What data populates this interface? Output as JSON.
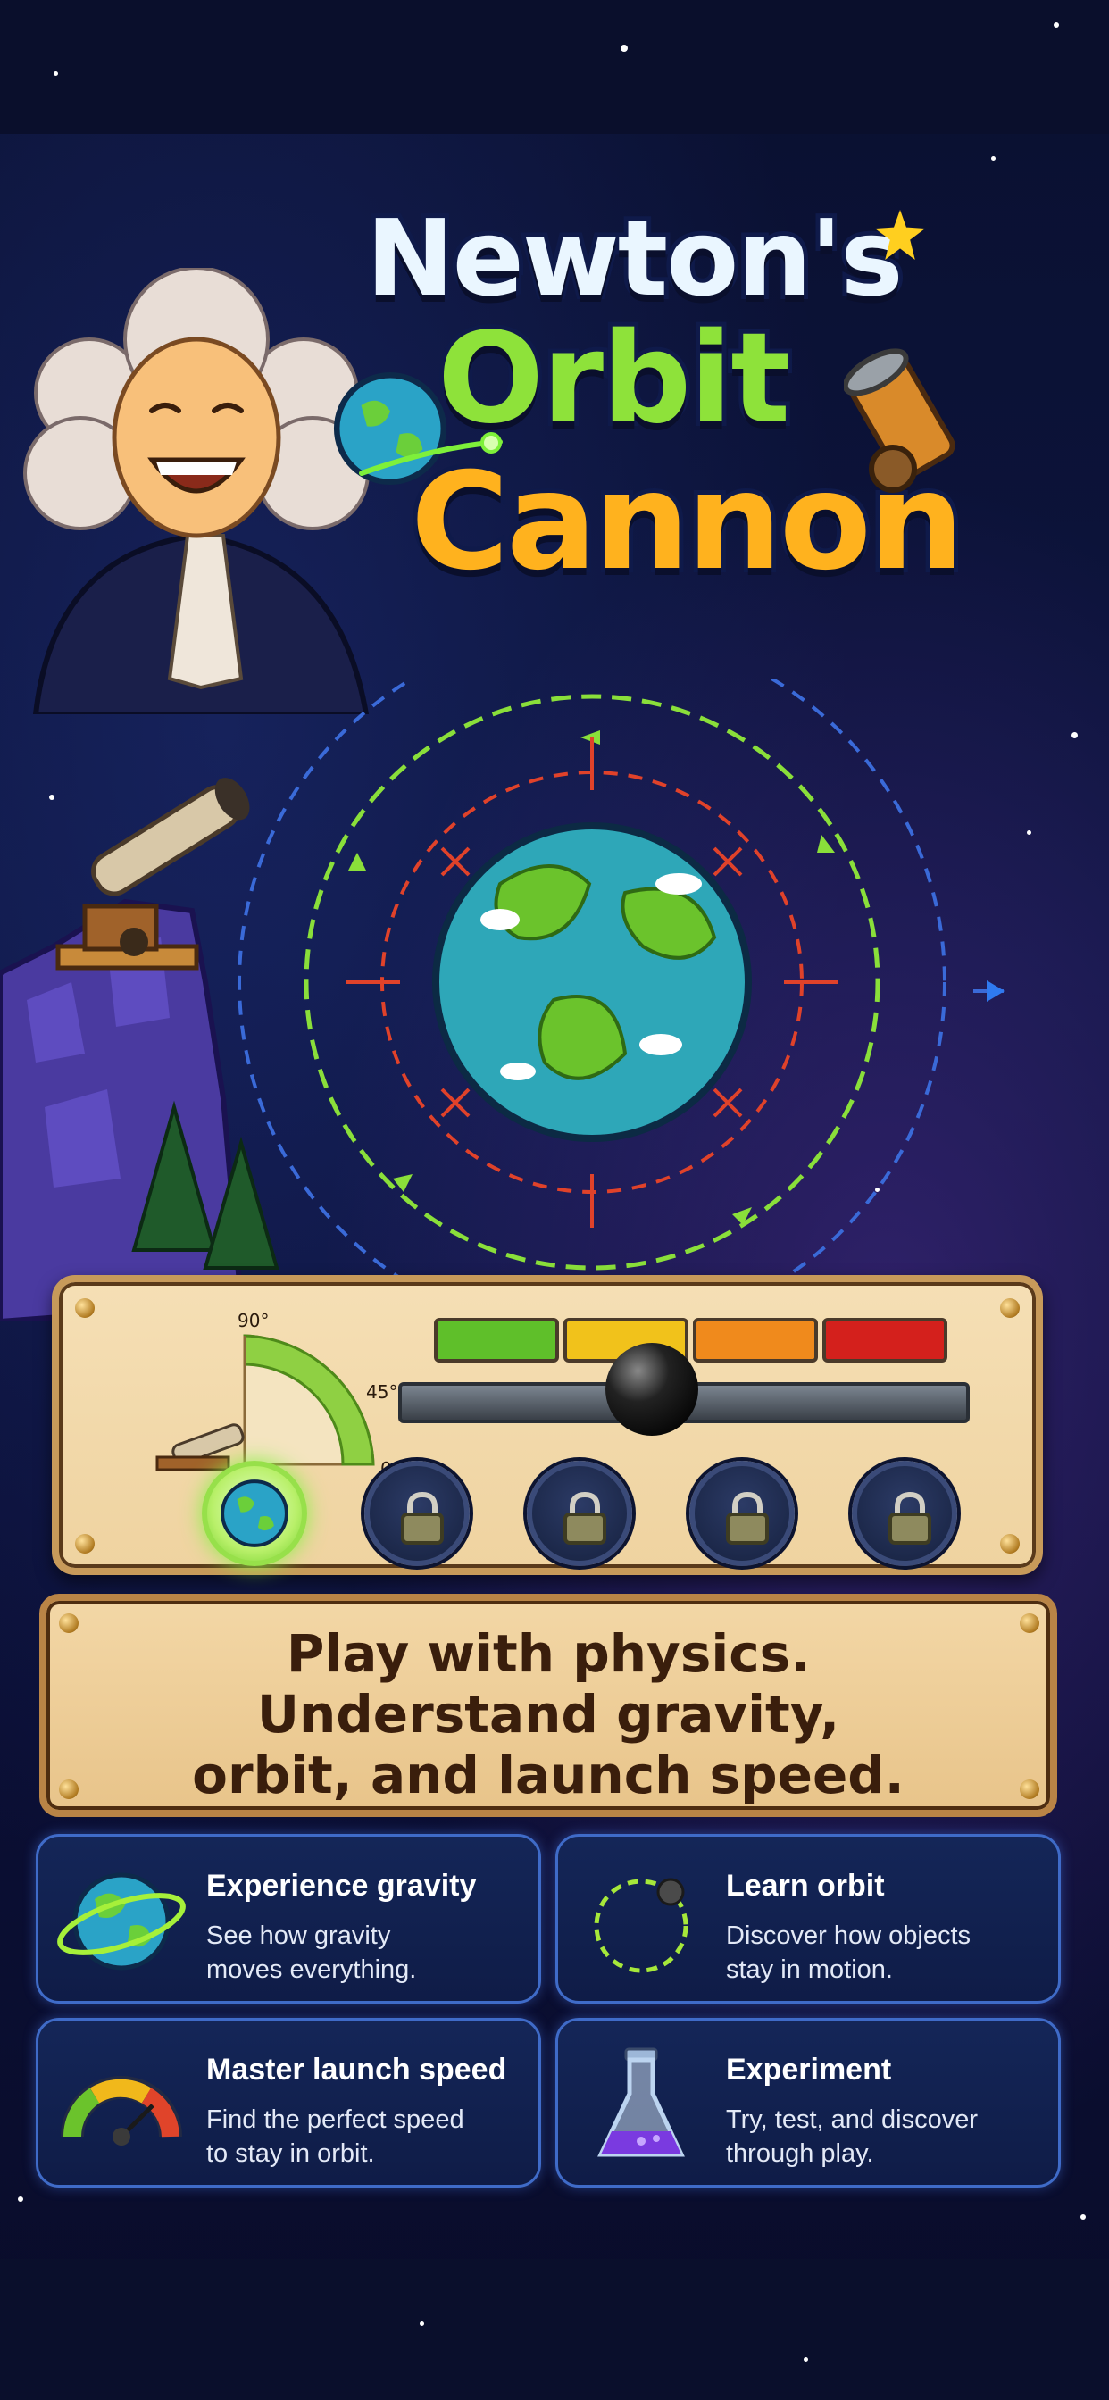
{
  "title": {
    "line1": "Newton's",
    "line2": "Orbit",
    "line3": "Cannon"
  },
  "launch_panel": {
    "angle_gauge": {
      "tick_90": "90°",
      "tick_45": "45°",
      "tick_0": "0°"
    },
    "power_bar_colors": [
      "#5fbf2a",
      "#f1c21b",
      "#f08a1c",
      "#d4201c"
    ],
    "levels": [
      {
        "state": "active",
        "icon": "earth-icon"
      },
      {
        "state": "locked",
        "icon": "padlock-icon"
      },
      {
        "state": "locked",
        "icon": "padlock-icon"
      },
      {
        "state": "locked",
        "icon": "padlock-icon"
      },
      {
        "state": "locked",
        "icon": "padlock-icon"
      }
    ]
  },
  "tagline": {
    "line1": "Play with physics.",
    "line2": "Understand gravity,",
    "line3": "orbit, and launch speed."
  },
  "features": [
    {
      "title": "Experience gravity",
      "desc_line1": "See how gravity",
      "desc_line2": "moves everything.",
      "icon": "ringed-earth-icon"
    },
    {
      "title": "Learn orbit",
      "desc_line1": "Discover how objects",
      "desc_line2": "stay in motion.",
      "icon": "orbit-path-icon"
    },
    {
      "title": "Master launch speed",
      "desc_line1": "Find the perfect speed",
      "desc_line2": "to stay in orbit.",
      "icon": "speedometer-icon"
    },
    {
      "title": "Experiment",
      "desc_line1": "Try, test, and discover",
      "desc_line2": "through play.",
      "icon": "flask-icon"
    }
  ],
  "colors": {
    "background": "#0b0f2e",
    "panel": "#f3d9a8",
    "card_border": "#3f6bc8",
    "title_white": "#eaf6ff",
    "title_green": "#8ee23a",
    "title_orange": "#ffb21e"
  }
}
